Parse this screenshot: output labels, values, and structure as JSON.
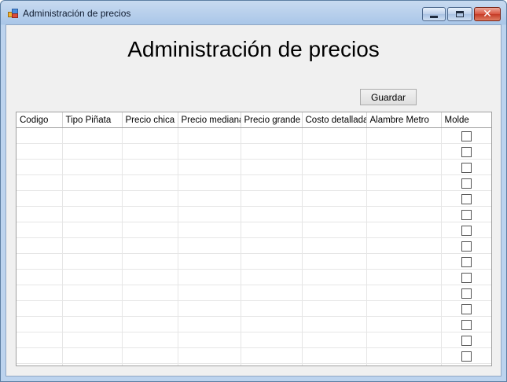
{
  "window": {
    "title": "Administración de precios",
    "controls": [
      "minimize-icon",
      "maximize-icon",
      "close-icon"
    ]
  },
  "form": {
    "heading": "Administración de precios",
    "save_label": "Guardar"
  },
  "grid": {
    "columns": [
      "Codigo",
      "Tipo Piñata",
      "Precio chica",
      "Precio mediana",
      "Precio grande",
      "Costo detallada",
      "Alambre Metro",
      "Molde"
    ],
    "row_count": 16
  }
}
